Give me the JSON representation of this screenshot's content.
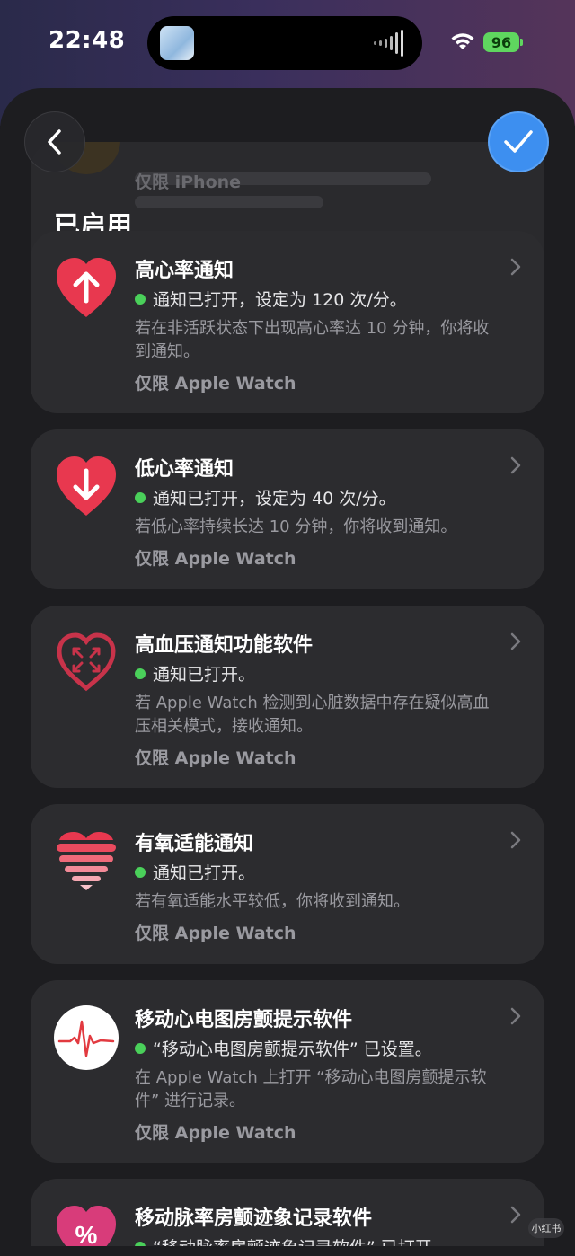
{
  "status_bar": {
    "time": "22:48",
    "battery": "96"
  },
  "prev_card": {
    "only": "仅限 iPhone"
  },
  "section_title": "已启用",
  "cards": [
    {
      "title": "高心率通知",
      "status": "通知已打开，设定为 120 次/分。",
      "desc": "若在非活跃状态下出现高心率达 10 分钟，你将收到通知。",
      "only": "仅限 Apple Watch",
      "icon": "heart-arrow-up-icon"
    },
    {
      "title": "低心率通知",
      "status": "通知已打开，设定为 40 次/分。",
      "desc": "若低心率持续长达 10 分钟，你将收到通知。",
      "only": "仅限 Apple Watch",
      "icon": "heart-arrow-down-icon"
    },
    {
      "title": "高血压通知功能软件",
      "status": "通知已打开。",
      "desc": "若 Apple Watch 检测到心脏数据中存在疑似高血压相关模式，接收通知。",
      "only": "仅限 Apple Watch",
      "icon": "heart-outline-arrows-icon"
    },
    {
      "title": "有氧适能通知",
      "status": "通知已打开。",
      "desc": "若有氧适能水平较低，你将收到通知。",
      "only": "仅限 Apple Watch",
      "icon": "striped-heart-icon"
    },
    {
      "title": "移动心电图房颤提示软件",
      "status": "“移动心电图房颤提示软件” 已设置。",
      "desc": "在 Apple Watch 上打开 “移动心电图房颤提示软件” 进行记录。",
      "only": "仅限 Apple Watch",
      "icon": "ecg-icon"
    },
    {
      "title": "移动脉率房颤迹象记录软件",
      "status": "“移动脉率房颤迹象记录软件” 已打开",
      "icon": "heart-percent-icon"
    }
  ],
  "watermark": "小红书",
  "colors": {
    "accent_blue": "#3d8ff0",
    "heart_red": "#e8384f",
    "status_green": "#4ad05a"
  }
}
